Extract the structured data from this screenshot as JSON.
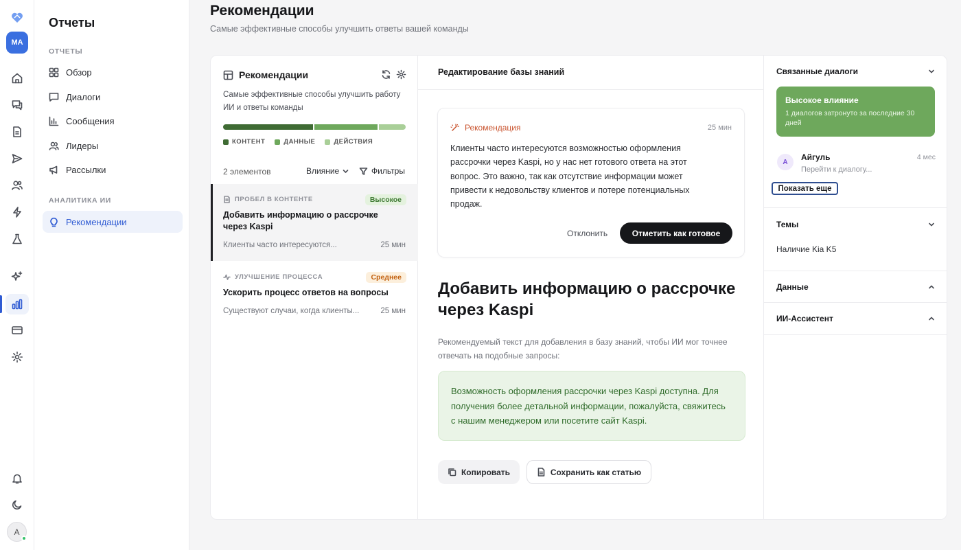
{
  "rail": {
    "avatar_initials": "MA",
    "user_initial": "A",
    "icons": [
      "logo-icon",
      "home-icon",
      "chat-icon",
      "document-icon",
      "send-icon",
      "users-icon",
      "bolt-icon",
      "flask-icon",
      "sparkle-icon",
      "bar-chart-icon",
      "card-icon",
      "gear-icon",
      "bell-icon",
      "moon-icon"
    ]
  },
  "nav": {
    "title": "Отчеты",
    "section_reports": "ОТЧЕТЫ",
    "section_ai": "АНАЛИТИКА ИИ",
    "items": [
      {
        "label": "Обзор",
        "icon": "grid-icon"
      },
      {
        "label": "Диалоги",
        "icon": "message-icon"
      },
      {
        "label": "Сообщения",
        "icon": "bar-icon"
      },
      {
        "label": "Лидеры",
        "icon": "users-icon"
      },
      {
        "label": "Рассылки",
        "icon": "megaphone-icon"
      }
    ],
    "ai_items": [
      {
        "label": "Рекомендации",
        "icon": "lightbulb-icon",
        "active": true
      }
    ]
  },
  "header": {
    "title": "Рекомендации",
    "subtitle": "Самые эффективные способы улучшить ответы вашей команды"
  },
  "list": {
    "title": "Рекомендации",
    "description": "Самые эффективные способы улучшить работу ИИ и ответы команды",
    "progress": [
      {
        "label": "КОНТЕНТ",
        "fraction": 0.5,
        "color": "#3f6b34"
      },
      {
        "label": "ДАННЫЕ",
        "fraction": 0.35,
        "color": "#6ea85c"
      },
      {
        "label": "ДЕЙСТВИЯ",
        "fraction": 0.15,
        "color": "#a9cf98"
      }
    ],
    "count": "2 элементов",
    "sort_label": "Влияние",
    "filter_label": "Фильтры",
    "items": [
      {
        "category": "ПРОБЕЛ В КОНТЕНТЕ",
        "badge": "Высокое",
        "title": "Добавить информацию о рассрочке через Kaspi",
        "preview": "Клиенты часто интересуются...",
        "time": "25 мин"
      },
      {
        "category": "УЛУЧШЕНИЕ ПРОЦЕССА",
        "badge": "Среднее",
        "title": "Ускорить процесс ответов на вопросы",
        "preview": "Существуют случаи, когда клиенты...",
        "time": "25 мин"
      }
    ]
  },
  "detail": {
    "header": "Редактирование базы знаний",
    "note_label": "Рекомендация",
    "note_time": "25 мин",
    "note_text": "Клиенты часто интересуются возможностью оформления рассрочки через Kaspi, но у нас нет готового ответа на этот вопрос. Это важно, так как отсутствие информации может привести к недовольству клиентов и потере потенциальных продаж.",
    "reject_label": "Отклонить",
    "done_label": "Отметить как готовое",
    "title": "Добавить информацию о рассрочке через Kaspi",
    "hint": "Рекомендуемый текст для добавления в базу знаний, чтобы ИИ мог точнее отвечать на подобные запросы:",
    "suggestion": "Возможность оформления рассрочки через Kaspi доступна. Для получения более детальной информации, пожалуйста, свяжитесь с нашим менеджером или посетите сайт Kaspi.",
    "copy_label": "Копировать",
    "save_label": "Сохранить как статью"
  },
  "side": {
    "related_title": "Связанные диалоги",
    "impact_title": "Высокое влияние",
    "impact_text": "1 диалогов затронуто за последние 30 дней",
    "dialog": {
      "initial": "A",
      "name": "Айгуль",
      "time": "4 мес",
      "sub": "Перейти к диалогу..."
    },
    "show_more": "Показать еще",
    "topics_title": "Темы",
    "topic": "Наличие Kia K5",
    "data_title": "Данные",
    "assistant_title": "ИИ-Ассистент"
  }
}
